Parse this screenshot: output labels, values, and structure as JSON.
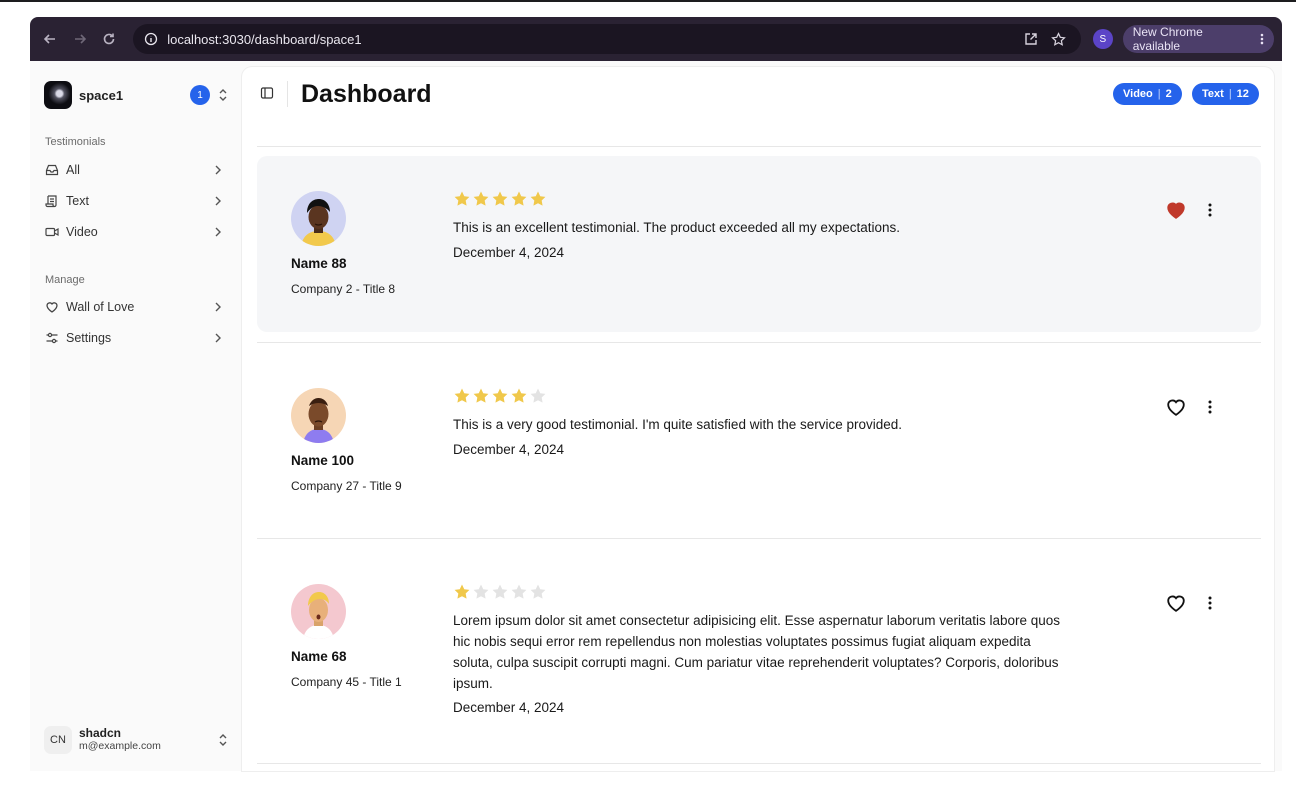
{
  "browser": {
    "url": "localhost:3030/dashboard/space1",
    "profile_initial": "S",
    "update_label": "New Chrome available"
  },
  "sidebar": {
    "team": {
      "name": "space1",
      "count": "1"
    },
    "groups": [
      {
        "label": "Testimonials",
        "items": [
          {
            "label": "All",
            "icon": "inbox-icon"
          },
          {
            "label": "Text",
            "icon": "scroll-icon"
          },
          {
            "label": "Video",
            "icon": "video-icon"
          }
        ]
      },
      {
        "label": "Manage",
        "items": [
          {
            "label": "Wall of Love",
            "icon": "heart-icon"
          },
          {
            "label": "Settings",
            "icon": "settings-icon"
          }
        ]
      }
    ],
    "user": {
      "initials": "CN",
      "name": "shadcn",
      "email": "m@example.com"
    }
  },
  "header": {
    "title": "Dashboard",
    "badges": [
      {
        "label": "Video",
        "count": "2"
      },
      {
        "label": "Text",
        "count": "12"
      }
    ]
  },
  "colors": {
    "accent": "#2563eb",
    "star": "#f0c84b",
    "star_empty": "#e3e3e3",
    "heart_filled": "#c0392b"
  },
  "testimonials": [
    {
      "name": "Name 88",
      "company": "Company 2 - Title 8",
      "rating": 5,
      "text": "This is an excellent testimonial. The product exceeded all my expectations.",
      "date": "December 4, 2024",
      "liked": true,
      "highlighted": true
    },
    {
      "name": "Name 100",
      "company": "Company 27 - Title 9",
      "rating": 4,
      "text": "This is a very good testimonial. I'm quite satisfied with the service provided.",
      "date": "December 4, 2024",
      "liked": false,
      "highlighted": false
    },
    {
      "name": "Name 68",
      "company": "Company 45 - Title 1",
      "rating": 1,
      "text": "Lorem ipsum dolor sit amet consectetur adipisicing elit. Esse aspernatur laborum veritatis labore quos hic nobis sequi error rem repellendus non molestias voluptates possimus fugiat aliquam expedita soluta, culpa suscipit corrupti magni. Cum pariatur vitae reprehenderit voluptates? Corporis, doloribus ipsum.",
      "date": "December 4, 2024",
      "liked": false,
      "highlighted": false
    }
  ]
}
